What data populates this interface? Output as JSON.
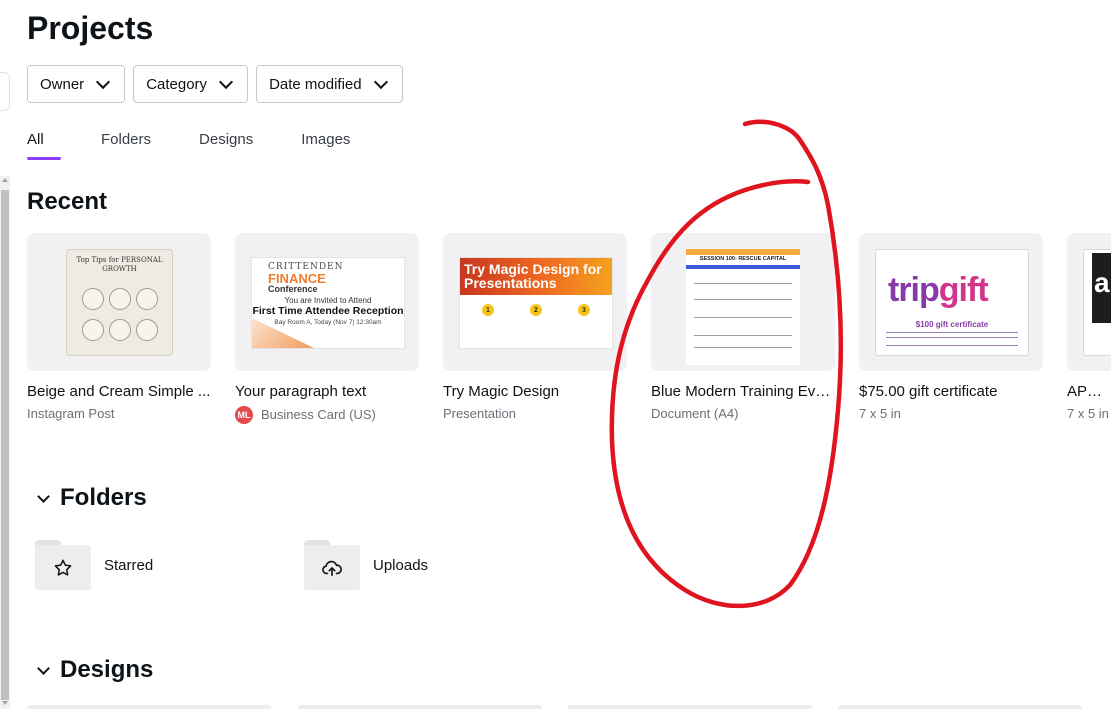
{
  "page": {
    "title": "Projects"
  },
  "filters": [
    {
      "label": "Owner"
    },
    {
      "label": "Category"
    },
    {
      "label": "Date modified"
    }
  ],
  "tabs": [
    {
      "label": "All",
      "active": true
    },
    {
      "label": "Folders"
    },
    {
      "label": "Designs"
    },
    {
      "label": "Images"
    }
  ],
  "recent": {
    "heading": "Recent",
    "cards": [
      {
        "title": "Beige and Cream Simple ...",
        "subtitle": "Instagram Post",
        "thumb": {
          "heading": "Top Tips for PERSONAL GROWTH",
          "bg": "#efebe2"
        }
      },
      {
        "title": "Your paragraph text",
        "subtitle": "Business Card (US)",
        "owner_initials": "ML",
        "thumb": {
          "line1": "CRITTENDEN",
          "line2": "FINANCE",
          "line3": "Conference",
          "line4": "You are Invited to Attend",
          "line5": "First Time Attendee Reception",
          "line6": "Bay Room A, Today (Nov 7) 12:30am",
          "accent": "#f07d2e"
        }
      },
      {
        "title": "Try Magic Design",
        "subtitle": "Presentation",
        "thumb": {
          "heading": "Try Magic Design for Presentations",
          "steps": [
            "1",
            "2",
            "3"
          ]
        }
      },
      {
        "title": "Blue Modern Training Eva...",
        "subtitle": "Document (A4)",
        "thumb": {
          "heading": "SESSION 100: RESCUE CAPITAL"
        }
      },
      {
        "title": "$75.00 gift certificate",
        "subtitle": "7 x 5 in",
        "thumb": {
          "logo_a": "trip",
          "logo_b": "gift",
          "cert": "$100 gift certificate"
        }
      },
      {
        "title": "APPLE",
        "subtitle": "7 x 5 in",
        "thumb": {
          "letter": "a"
        }
      }
    ]
  },
  "folders": {
    "heading": "Folders",
    "items": [
      {
        "label": "Starred",
        "icon": "star-icon"
      },
      {
        "label": "Uploads",
        "icon": "cloud-upload-icon"
      }
    ]
  },
  "designs": {
    "heading": "Designs"
  },
  "colors": {
    "accent": "#8b3dff",
    "annotation": "#e0141e"
  }
}
